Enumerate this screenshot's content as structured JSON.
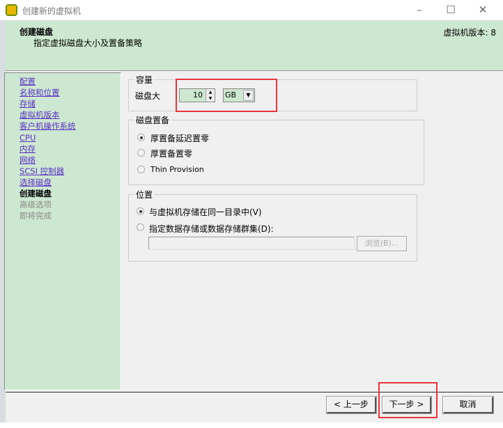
{
  "window": {
    "title": "创建新的虚拟机",
    "minimize": "–",
    "maximize": "☐",
    "close": "✕"
  },
  "header": {
    "title": "创建磁盘",
    "subtitle": "指定虚拟磁盘大小及置备策略",
    "version": "虚拟机版本: 8"
  },
  "sidebar": {
    "items": [
      {
        "label": "配置",
        "state": "link"
      },
      {
        "label": "名称和位置",
        "state": "link"
      },
      {
        "label": "存储",
        "state": "link"
      },
      {
        "label": "虚拟机版本",
        "state": "link"
      },
      {
        "label": "客户机操作系统",
        "state": "link"
      },
      {
        "label": "CPU",
        "state": "link"
      },
      {
        "label": "内存",
        "state": "link"
      },
      {
        "label": "网络",
        "state": "link"
      },
      {
        "label": "SCSI 控制器",
        "state": "link"
      },
      {
        "label": "选择磁盘",
        "state": "link"
      },
      {
        "label": "创建磁盘",
        "state": "current"
      },
      {
        "label": "高级选项",
        "state": "disabled"
      },
      {
        "label": "即将完成",
        "state": "disabled"
      }
    ]
  },
  "capacity": {
    "legend": "容量",
    "label": "磁盘大",
    "value": "10",
    "unit": "GB"
  },
  "provisioning": {
    "legend": "磁盘置备",
    "options": [
      {
        "label": "厚置备延迟置零",
        "selected": true
      },
      {
        "label": "厚置备置零",
        "selected": false
      },
      {
        "label": "Thin Provision",
        "selected": false
      }
    ]
  },
  "location": {
    "legend": "位置",
    "options": [
      {
        "label": "与虚拟机存储在同一目录中(V)",
        "selected": true
      },
      {
        "label": "指定数据存储或数据存储群集(D):",
        "selected": false
      }
    ],
    "path_value": "",
    "browse": "浏览(B)..."
  },
  "buttons": {
    "back": "< 上一步",
    "next": "下一步 >",
    "cancel": "取消"
  },
  "colors": {
    "header_bg": "#cde8d0",
    "highlight": "#e8343a",
    "link": "#5a2fc6"
  }
}
